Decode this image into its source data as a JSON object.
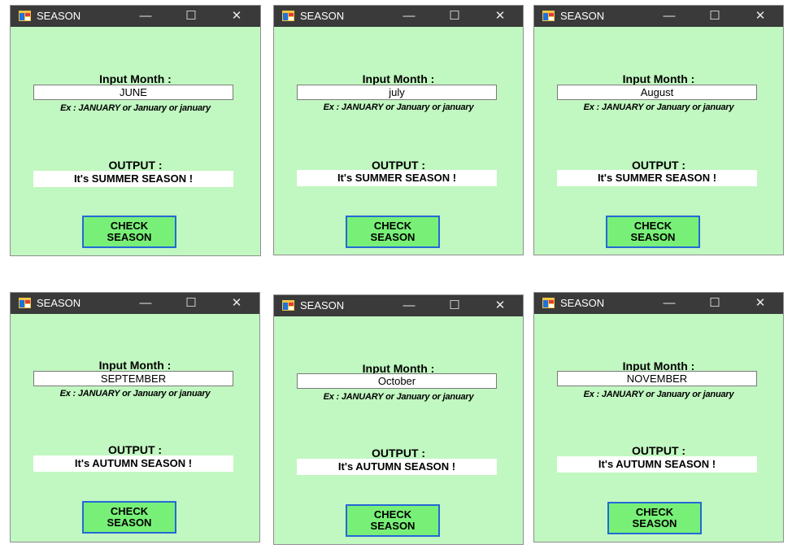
{
  "common": {
    "title": "SEASON",
    "input_label": "Input Month :",
    "hint": "Ex : JANUARY or January or january",
    "output_label": "OUTPUT :",
    "button_line1": "CHECK",
    "button_line2": "SEASON",
    "minimize_glyph": "—",
    "maximize_glyph": "☐",
    "close_glyph": "✕",
    "colors": {
      "window_bg": "#c1f7c1",
      "titlebar": "#3a3a3a",
      "button_bg": "#78f078",
      "button_border": "#2469d6"
    }
  },
  "windows": [
    {
      "input": "JUNE",
      "output": "It's SUMMER SEASON !"
    },
    {
      "input": "july",
      "output": "It's SUMMER SEASON !"
    },
    {
      "input": "August",
      "output": "It's SUMMER SEASON !"
    },
    {
      "input": "SEPTEMBER",
      "output": "It's AUTUMN SEASON !"
    },
    {
      "input": "October",
      "output": "It's AUTUMN SEASON !"
    },
    {
      "input": "NOVEMBER",
      "output": "It's AUTUMN SEASON !"
    }
  ]
}
